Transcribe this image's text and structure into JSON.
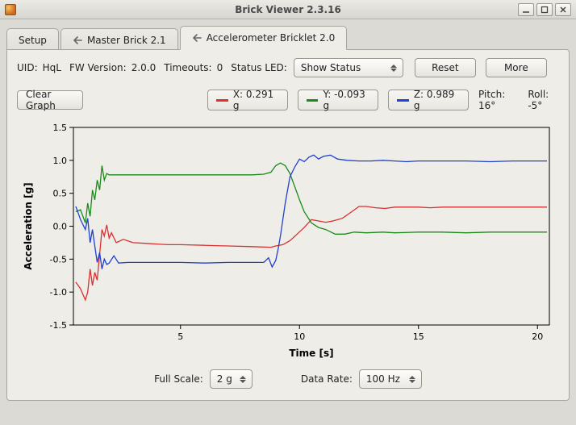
{
  "window": {
    "title": "Brick Viewer 2.3.16"
  },
  "tabs": {
    "setup": "Setup",
    "master": "Master Brick 2.1",
    "accel": "Accelerometer Bricklet 2.0"
  },
  "info": {
    "uid_label": "UID:",
    "uid_value": "HqL",
    "fw_label": "FW Version:",
    "fw_value": "2.0.0",
    "timeouts_label": "Timeouts:",
    "timeouts_value": "0",
    "statusled_label": "Status LED:",
    "statusled_value": "Show Status",
    "reset": "Reset",
    "more": "More"
  },
  "controls": {
    "clear_graph": "Clear Graph",
    "x_label": "X: 0.291 g",
    "y_label": "Y: -0.093 g",
    "z_label": "Z: 0.989 g",
    "pitch": "Pitch: 16°",
    "roll": "Roll: -5°"
  },
  "bottom": {
    "fullscale_label": "Full Scale:",
    "fullscale_value": "2 g",
    "datarate_label": "Data Rate:",
    "datarate_value": "100 Hz"
  },
  "colors": {
    "x": "#d93030",
    "y": "#1a8a1a",
    "z": "#2040d0"
  },
  "chart_data": {
    "type": "line",
    "xlabel": "Time [s]",
    "ylabel": "Acceleration [g]",
    "xlim": [
      0.5,
      20.5
    ],
    "ylim": [
      -1.5,
      1.5
    ],
    "xticks": [
      5,
      10,
      15,
      20
    ],
    "yticks": [
      -1.5,
      -1.0,
      -0.5,
      0.0,
      0.5,
      1.0,
      1.5
    ],
    "series": [
      {
        "name": "X",
        "color": "#d93030",
        "points": [
          [
            0.6,
            -0.85
          ],
          [
            0.8,
            -0.95
          ],
          [
            1.0,
            -1.12
          ],
          [
            1.1,
            -1.0
          ],
          [
            1.2,
            -0.65
          ],
          [
            1.3,
            -0.9
          ],
          [
            1.4,
            -0.7
          ],
          [
            1.5,
            -0.82
          ],
          [
            1.7,
            -0.05
          ],
          [
            1.8,
            -0.15
          ],
          [
            1.9,
            0.02
          ],
          [
            2.0,
            -0.18
          ],
          [
            2.1,
            -0.1
          ],
          [
            2.3,
            -0.25
          ],
          [
            2.6,
            -0.2
          ],
          [
            3.0,
            -0.25
          ],
          [
            3.5,
            -0.26
          ],
          [
            4.0,
            -0.27
          ],
          [
            4.5,
            -0.28
          ],
          [
            5.0,
            -0.28
          ],
          [
            6.0,
            -0.29
          ],
          [
            7.0,
            -0.3
          ],
          [
            8.0,
            -0.31
          ],
          [
            8.8,
            -0.32
          ],
          [
            9.0,
            -0.3
          ],
          [
            9.3,
            -0.28
          ],
          [
            9.6,
            -0.22
          ],
          [
            9.9,
            -0.12
          ],
          [
            10.2,
            -0.02
          ],
          [
            10.5,
            0.1
          ],
          [
            10.8,
            0.08
          ],
          [
            11.1,
            0.06
          ],
          [
            11.4,
            0.08
          ],
          [
            11.8,
            0.12
          ],
          [
            12.2,
            0.22
          ],
          [
            12.5,
            0.3
          ],
          [
            12.8,
            0.3
          ],
          [
            13.2,
            0.28
          ],
          [
            13.6,
            0.27
          ],
          [
            14.0,
            0.29
          ],
          [
            14.5,
            0.29
          ],
          [
            15.0,
            0.29
          ],
          [
            15.5,
            0.28
          ],
          [
            16.0,
            0.29
          ],
          [
            17.0,
            0.29
          ],
          [
            18.0,
            0.29
          ],
          [
            19.0,
            0.29
          ],
          [
            20.0,
            0.29
          ],
          [
            20.4,
            0.29
          ]
        ]
      },
      {
        "name": "Y",
        "color": "#1a8a1a",
        "points": [
          [
            0.6,
            0.22
          ],
          [
            0.8,
            0.25
          ],
          [
            1.0,
            0.05
          ],
          [
            1.1,
            0.35
          ],
          [
            1.2,
            0.15
          ],
          [
            1.3,
            0.55
          ],
          [
            1.4,
            0.4
          ],
          [
            1.5,
            0.7
          ],
          [
            1.6,
            0.55
          ],
          [
            1.7,
            0.92
          ],
          [
            1.8,
            0.7
          ],
          [
            1.9,
            0.8
          ],
          [
            2.0,
            0.78
          ],
          [
            2.3,
            0.78
          ],
          [
            2.8,
            0.78
          ],
          [
            3.5,
            0.78
          ],
          [
            4.0,
            0.78
          ],
          [
            5.0,
            0.78
          ],
          [
            6.0,
            0.78
          ],
          [
            7.0,
            0.78
          ],
          [
            8.0,
            0.78
          ],
          [
            8.5,
            0.79
          ],
          [
            8.8,
            0.82
          ],
          [
            9.0,
            0.92
          ],
          [
            9.2,
            0.96
          ],
          [
            9.4,
            0.92
          ],
          [
            9.6,
            0.8
          ],
          [
            9.8,
            0.6
          ],
          [
            10.0,
            0.4
          ],
          [
            10.2,
            0.22
          ],
          [
            10.5,
            0.05
          ],
          [
            10.8,
            -0.02
          ],
          [
            11.1,
            -0.05
          ],
          [
            11.5,
            -0.12
          ],
          [
            11.9,
            -0.12
          ],
          [
            12.3,
            -0.09
          ],
          [
            12.8,
            -0.1
          ],
          [
            13.5,
            -0.09
          ],
          [
            14.0,
            -0.1
          ],
          [
            15.0,
            -0.09
          ],
          [
            16.0,
            -0.09
          ],
          [
            17.0,
            -0.1
          ],
          [
            18.0,
            -0.09
          ],
          [
            19.0,
            -0.09
          ],
          [
            20.0,
            -0.09
          ],
          [
            20.4,
            -0.09
          ]
        ]
      },
      {
        "name": "Z",
        "color": "#2040d0",
        "points": [
          [
            0.6,
            0.3
          ],
          [
            0.8,
            0.1
          ],
          [
            1.0,
            -0.05
          ],
          [
            1.1,
            0.12
          ],
          [
            1.2,
            -0.25
          ],
          [
            1.3,
            -0.05
          ],
          [
            1.4,
            -0.3
          ],
          [
            1.5,
            -0.55
          ],
          [
            1.6,
            -0.4
          ],
          [
            1.7,
            -0.65
          ],
          [
            1.8,
            -0.5
          ],
          [
            1.9,
            -0.58
          ],
          [
            2.0,
            -0.56
          ],
          [
            2.2,
            -0.45
          ],
          [
            2.4,
            -0.56
          ],
          [
            2.8,
            -0.55
          ],
          [
            3.5,
            -0.55
          ],
          [
            4.0,
            -0.55
          ],
          [
            5.0,
            -0.55
          ],
          [
            6.0,
            -0.56
          ],
          [
            7.0,
            -0.55
          ],
          [
            8.0,
            -0.55
          ],
          [
            8.5,
            -0.55
          ],
          [
            8.7,
            -0.48
          ],
          [
            8.85,
            -0.62
          ],
          [
            9.0,
            -0.52
          ],
          [
            9.1,
            -0.35
          ],
          [
            9.2,
            -0.15
          ],
          [
            9.3,
            0.1
          ],
          [
            9.4,
            0.35
          ],
          [
            9.5,
            0.55
          ],
          [
            9.6,
            0.75
          ],
          [
            9.8,
            0.9
          ],
          [
            10.0,
            1.02
          ],
          [
            10.2,
            0.98
          ],
          [
            10.4,
            1.05
          ],
          [
            10.6,
            1.08
          ],
          [
            10.8,
            1.02
          ],
          [
            11.0,
            1.06
          ],
          [
            11.3,
            1.08
          ],
          [
            11.6,
            1.02
          ],
          [
            12.0,
            1.0
          ],
          [
            12.5,
            0.99
          ],
          [
            13.0,
            0.99
          ],
          [
            13.5,
            1.0
          ],
          [
            14.0,
            0.99
          ],
          [
            14.5,
            0.98
          ],
          [
            15.0,
            0.99
          ],
          [
            16.0,
            0.99
          ],
          [
            17.0,
            0.99
          ],
          [
            18.0,
            0.98
          ],
          [
            19.0,
            0.99
          ],
          [
            20.0,
            0.99
          ],
          [
            20.4,
            0.99
          ]
        ]
      }
    ]
  }
}
